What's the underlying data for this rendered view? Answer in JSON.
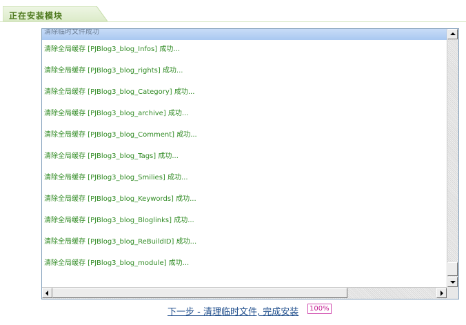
{
  "header": {
    "title": "正在安装模块"
  },
  "log": {
    "first_line_partial": "清除临时文件成功",
    "lines": [
      "清除全局缓存 [PJBlog3_blog_Infos] 成功...",
      "清除全局缓存 [PJBlog3_blog_rights] 成功...",
      "清除全局缓存 [PJBlog3_blog_Category] 成功...",
      "清除全局缓存 [PJBlog3_blog_archive] 成功...",
      "清除全局缓存 [PJBlog3_blog_Comment] 成功...",
      "清除全局缓存 [PJBlog3_blog_Tags] 成功...",
      "清除全局缓存 [PJBlog3_blog_Smilies] 成功...",
      "清除全局缓存 [PJBlog3_blog_Keywords] 成功...",
      "清除全局缓存 [PJBlog3_blog_Bloglinks] 成功...",
      "清除全局缓存 [PJBlog3_blog_ReBuildID] 成功...",
      "清除全局缓存 [PJBlog3_blog_module] 成功..."
    ]
  },
  "footer": {
    "next_link": "下一步 - 清理临时文件, 完成安装",
    "progress": "100%"
  },
  "colors": {
    "header_text": "#4f7a1f",
    "log_text": "#2f8a22",
    "link": "#1f4e8c",
    "progress_border": "#d14fb0"
  }
}
